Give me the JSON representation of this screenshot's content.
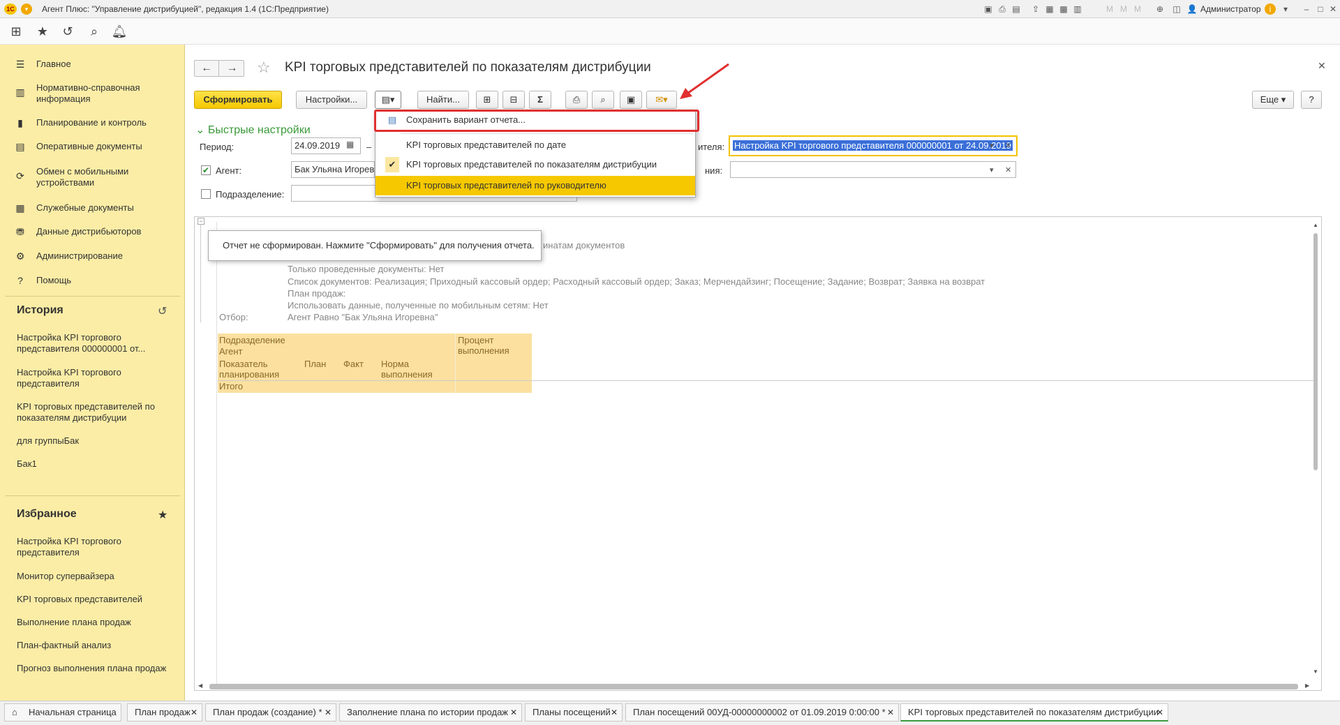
{
  "window": {
    "title": "Агент Плюс: \"Управление дистрибуцией\", редакция 1.4  (1С:Предприятие)",
    "user": "Администратор"
  },
  "sidebar": {
    "items": [
      {
        "label": "Главное",
        "icon": "menu-lines-icon"
      },
      {
        "label": "Нормативно-справочная информация",
        "icon": "reference-book-icon"
      },
      {
        "label": "Планирование и контроль",
        "icon": "bar-chart-icon"
      },
      {
        "label": "Оперативные документы",
        "icon": "documents-icon"
      },
      {
        "label": "Обмен с мобильными устройствами",
        "icon": "sync-icon"
      },
      {
        "label": "Служебные документы",
        "icon": "service-docs-icon"
      },
      {
        "label": "Данные дистрибьюторов",
        "icon": "distributor-icon"
      },
      {
        "label": "Администрирование",
        "icon": "gear-icon"
      },
      {
        "label": "Помощь",
        "icon": "question-icon"
      }
    ],
    "history": {
      "title": "История",
      "items": [
        "Настройка KPI торгового представителя 000000001 от...",
        "Настройка KPI торгового представителя",
        "KPI торговых представителей по показателям дистрибуции",
        "для группыБак",
        "Бак1"
      ]
    },
    "favorites": {
      "title": "Избранное",
      "items": [
        "Настройка KPI торгового представителя",
        "Монитор супервайзера",
        "KPI торговых представителей",
        "Выполнение плана продаж",
        "План-фактный анализ",
        "Прогноз выполнения плана продаж"
      ]
    }
  },
  "form": {
    "title": "KPI торговых представителей по показателям дистрибуции",
    "buttons": {
      "generate": "Сформировать",
      "settings": "Настройки...",
      "find": "Найти...",
      "more": "Еще",
      "help": "?"
    },
    "quick_settings_title": "Быстрые настройки",
    "period_label": "Период:",
    "period_value": "24.09.2019",
    "period_dash": "–",
    "agent_label": "Агент:",
    "agent_value": "Бак Ульяна Игоревна",
    "subdivision_label": "Подразделение:",
    "kpi_label_tail": "ителя:",
    "kpi_value": "Настройка KPI торгового представителя 000000001 от 24.09.2019",
    "second_label_tail": "ния:"
  },
  "dropdown": {
    "items": [
      {
        "label": "Сохранить вариант отчета...",
        "mark": ""
      },
      {
        "label": "KPI торговых представителей по дате",
        "mark": ""
      },
      {
        "label": "KPI торговых представителей по показателям дистрибуции",
        "mark": "✔"
      },
      {
        "label": "KPI торговых представителей по руководителю",
        "mark": ""
      }
    ]
  },
  "report": {
    "tooltip": "Отчет не сформирован. Нажмите \"Сформировать\" для получения отчета.",
    "params_tail": "инатам документов",
    "lines": [
      "Только проведенные документы: Нет",
      "Список документов: Реализация; Приходный кассовый ордер; Расходный кассовый ордер; Заказ; Мерчендайзинг; Посещение; Задание; Возврат; Заявка на возврат",
      "План продаж:",
      "Использовать данные, полученные по мобильным сетям: Нет"
    ],
    "filter_label": "Отбор:",
    "filter_value": "Агент Равно \"Бак Ульяна Игоревна\"",
    "table": {
      "subdivision": "Подразделение",
      "agent": "Агент",
      "indicator": "Показатель планирования",
      "plan": "План",
      "fact": "Факт",
      "norm": "Норма выполнения",
      "percent": "Процент выполнения",
      "total": "Итого"
    }
  },
  "tabs": [
    {
      "label": "Начальная страница"
    },
    {
      "label": "План продаж"
    },
    {
      "label": "План продаж (создание) *"
    },
    {
      "label": "Заполнение плана  по истории продаж"
    },
    {
      "label": "Планы посещений"
    },
    {
      "label": "План посещений 00УД-00000000002 от 01.09.2019 0:00:00 *"
    },
    {
      "label": "KPI торговых представителей по показателям дистрибуции"
    }
  ],
  "colors": {
    "sidebar_bg": "#fbeda6",
    "primary_button": "#f6c800",
    "accent_green": "#3a9a3a",
    "highlight_red": "#e03030",
    "selected_item": "#f6c800"
  }
}
